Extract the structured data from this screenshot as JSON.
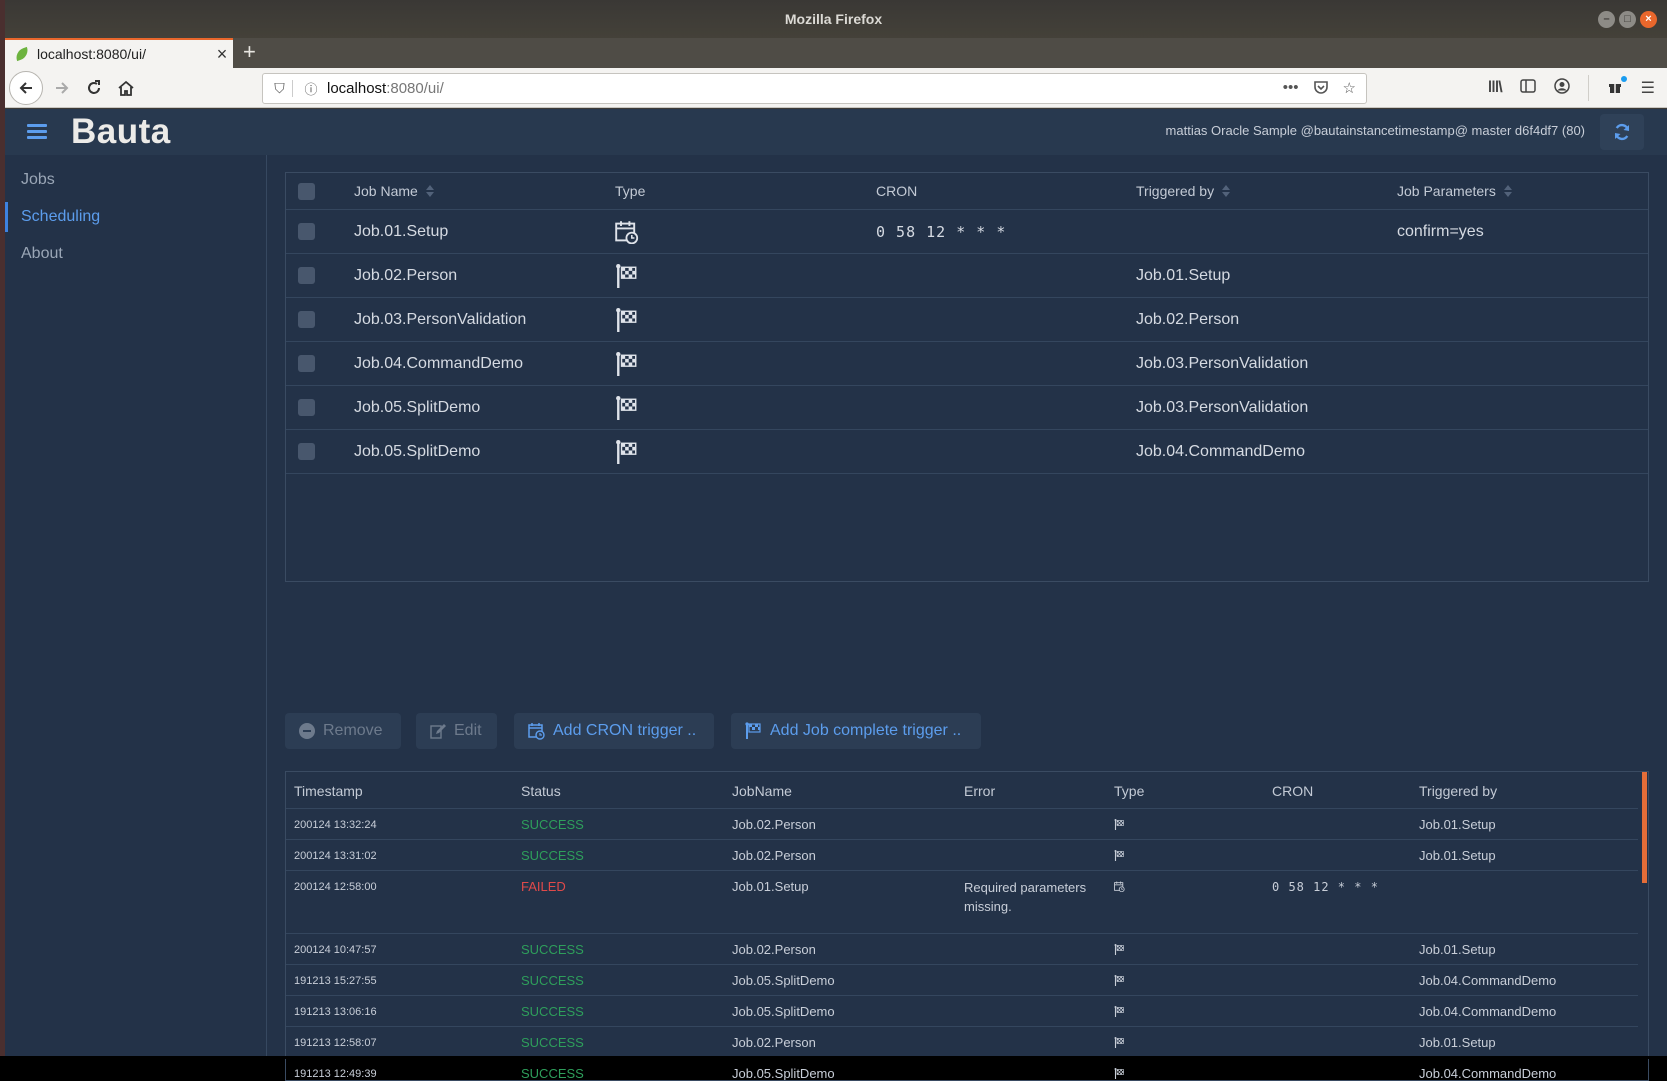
{
  "window": {
    "title": "Mozilla Firefox",
    "controls": {
      "minimize": "–",
      "maximize": "□",
      "close": "×"
    }
  },
  "browser": {
    "tab_title": "localhost:8080/ui/",
    "tab_close": "×",
    "new_tab": "+",
    "url_host": "localhost",
    "url_rest": ":8080/ui/",
    "url_more": "•••"
  },
  "app": {
    "brand": "Bauta",
    "header_info": "mattias Oracle Sample @bautainstancetimestamp@ master d6f4df7 (80)",
    "accent": "#5c9ded"
  },
  "sidebar": {
    "items": [
      {
        "label": "Jobs",
        "active": false
      },
      {
        "label": "Scheduling",
        "active": true
      },
      {
        "label": "About",
        "active": false
      }
    ]
  },
  "job_table": {
    "headers": {
      "job_name": "Job Name",
      "type": "Type",
      "cron": "CRON",
      "triggered_by": "Triggered by",
      "job_parameters": "Job Parameters"
    },
    "rows": [
      {
        "job_name": "Job.01.Setup",
        "type": "cron",
        "cron": "0 58 12 * * *",
        "triggered_by": "",
        "job_parameters": "confirm=yes"
      },
      {
        "job_name": "Job.02.Person",
        "type": "job-complete",
        "cron": "",
        "triggered_by": "Job.01.Setup",
        "job_parameters": ""
      },
      {
        "job_name": "Job.03.PersonValidation",
        "type": "job-complete",
        "cron": "",
        "triggered_by": "Job.02.Person",
        "job_parameters": ""
      },
      {
        "job_name": "Job.04.CommandDemo",
        "type": "job-complete",
        "cron": "",
        "triggered_by": "Job.03.PersonValidation",
        "job_parameters": ""
      },
      {
        "job_name": "Job.05.SplitDemo",
        "type": "job-complete",
        "cron": "",
        "triggered_by": "Job.03.PersonValidation",
        "job_parameters": ""
      },
      {
        "job_name": "Job.05.SplitDemo",
        "type": "job-complete",
        "cron": "",
        "triggered_by": "Job.04.CommandDemo",
        "job_parameters": ""
      }
    ]
  },
  "actions": {
    "remove": "Remove",
    "edit": "Edit",
    "add_cron": "Add CRON trigger ..",
    "add_job_complete": "Add Job complete trigger .."
  },
  "history_table": {
    "headers": {
      "timestamp": "Timestamp",
      "status": "Status",
      "job_name": "JobName",
      "error": "Error",
      "type": "Type",
      "cron": "CRON",
      "triggered_by": "Triggered by"
    },
    "status_colors": {
      "SUCCESS": "#2e9e5b",
      "FAILED": "#e04a4a"
    },
    "rows": [
      {
        "timestamp": "200124 13:32:24",
        "status": "SUCCESS",
        "job_name": "Job.02.Person",
        "error": "",
        "type": "job-complete",
        "cron": "",
        "triggered_by": "Job.01.Setup"
      },
      {
        "timestamp": "200124 13:31:02",
        "status": "SUCCESS",
        "job_name": "Job.02.Person",
        "error": "",
        "type": "job-complete",
        "cron": "",
        "triggered_by": "Job.01.Setup"
      },
      {
        "timestamp": "200124 12:58:00",
        "status": "FAILED",
        "job_name": "Job.01.Setup",
        "error": "Required parameters missing.",
        "type": "cron",
        "cron": "0 58 12 * * *",
        "triggered_by": ""
      },
      {
        "timestamp": "200124 10:47:57",
        "status": "SUCCESS",
        "job_name": "Job.02.Person",
        "error": "",
        "type": "job-complete",
        "cron": "",
        "triggered_by": "Job.01.Setup"
      },
      {
        "timestamp": "191213 15:27:55",
        "status": "SUCCESS",
        "job_name": "Job.05.SplitDemo",
        "error": "",
        "type": "job-complete",
        "cron": "",
        "triggered_by": "Job.04.CommandDemo"
      },
      {
        "timestamp": "191213 13:06:16",
        "status": "SUCCESS",
        "job_name": "Job.05.SplitDemo",
        "error": "",
        "type": "job-complete",
        "cron": "",
        "triggered_by": "Job.04.CommandDemo"
      },
      {
        "timestamp": "191213 12:58:07",
        "status": "SUCCESS",
        "job_name": "Job.02.Person",
        "error": "",
        "type": "job-complete",
        "cron": "",
        "triggered_by": "Job.01.Setup"
      },
      {
        "timestamp": "191213 12:49:39",
        "status": "SUCCESS",
        "job_name": "Job.05.SplitDemo",
        "error": "",
        "type": "job-complete",
        "cron": "",
        "triggered_by": "Job.04.CommandDemo"
      }
    ]
  }
}
